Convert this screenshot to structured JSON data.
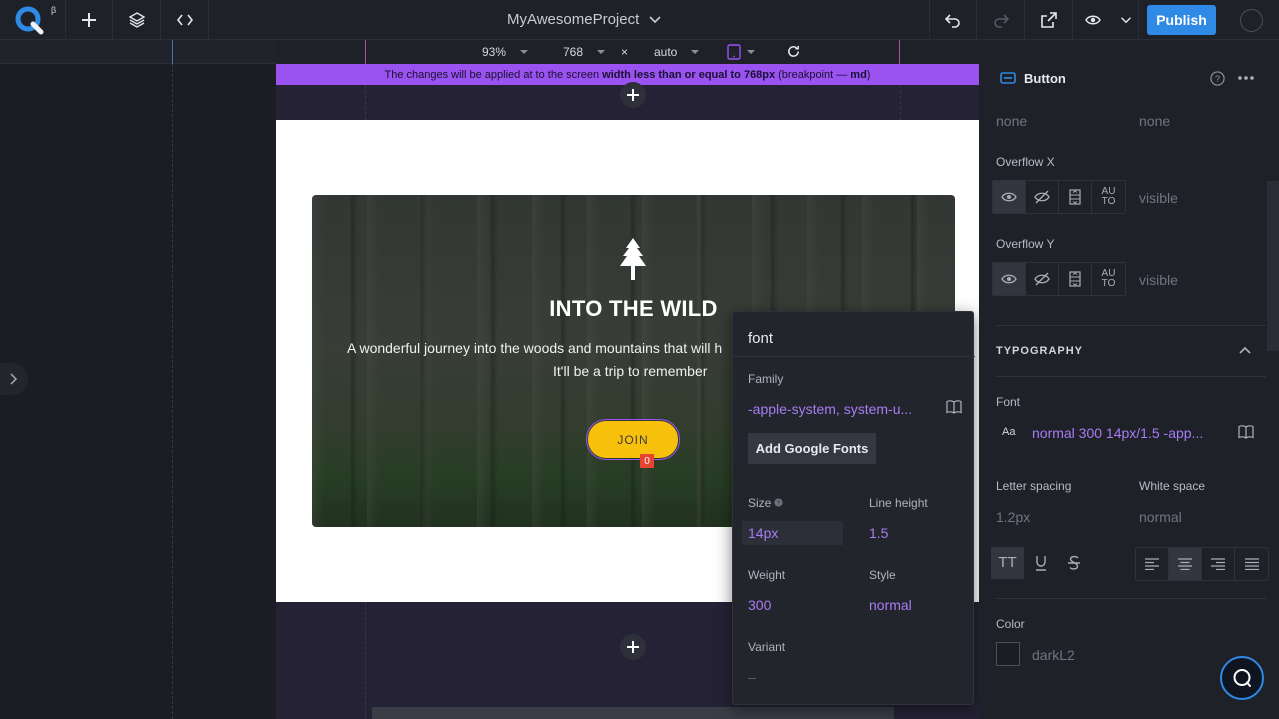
{
  "topbar": {
    "logo_beta": "β",
    "project_name": "MyAwesomeProject",
    "publish_label": "Publish"
  },
  "frame_toolbar": {
    "zoom": "93%",
    "width": "768",
    "times": "×",
    "height": "auto"
  },
  "breakpoint_notice": {
    "prefix": "The changes will be applied at to the screen",
    "bold_rule": "width less than or equal to 768px",
    "mid": "(breakpoint —",
    "bp": "md",
    "suffix": ")"
  },
  "hero": {
    "title": "INTO THE WILD",
    "line1": "A wonderful journey into the woods and mountains that will h",
    "line2": "It'll be a trip to remember",
    "button_label": "JOIN",
    "badge": "0"
  },
  "font_popup": {
    "title": "font",
    "family_label": "Family",
    "family_value": "-apple-system, system-u...",
    "add_fonts_label": "Add Google Fonts",
    "size_label": "Size",
    "size_value": "14px",
    "line_height_label": "Line height",
    "line_height_value": "1.5",
    "weight_label": "Weight",
    "weight_value": "300",
    "style_label": "Style",
    "style_value": "normal",
    "variant_label": "Variant",
    "variant_value": "–"
  },
  "panel": {
    "component_name": "Button",
    "none_left": "none",
    "none_right": "none",
    "overflow_x_label": "Overflow X",
    "overflow_x_value": "visible",
    "overflow_y_label": "Overflow Y",
    "overflow_y_value": "visible",
    "auto_label_1": "AU",
    "auto_label_2": "TO",
    "typography_title": "TYPOGRAPHY",
    "font_label": "Font",
    "font_aa": "Aa",
    "font_value": "normal 300 14px/1.5 -app...",
    "letter_spacing_label": "Letter spacing",
    "letter_spacing_value": "1.2px",
    "white_space_label": "White space",
    "white_space_value": "normal",
    "tt_label": "TT",
    "color_label": "Color",
    "color_value": "darkL2"
  },
  "colors": {
    "accent": "#9a52f0",
    "publish": "#2f8ae6",
    "join": "#f7c10b",
    "badge": "#e5442f"
  }
}
